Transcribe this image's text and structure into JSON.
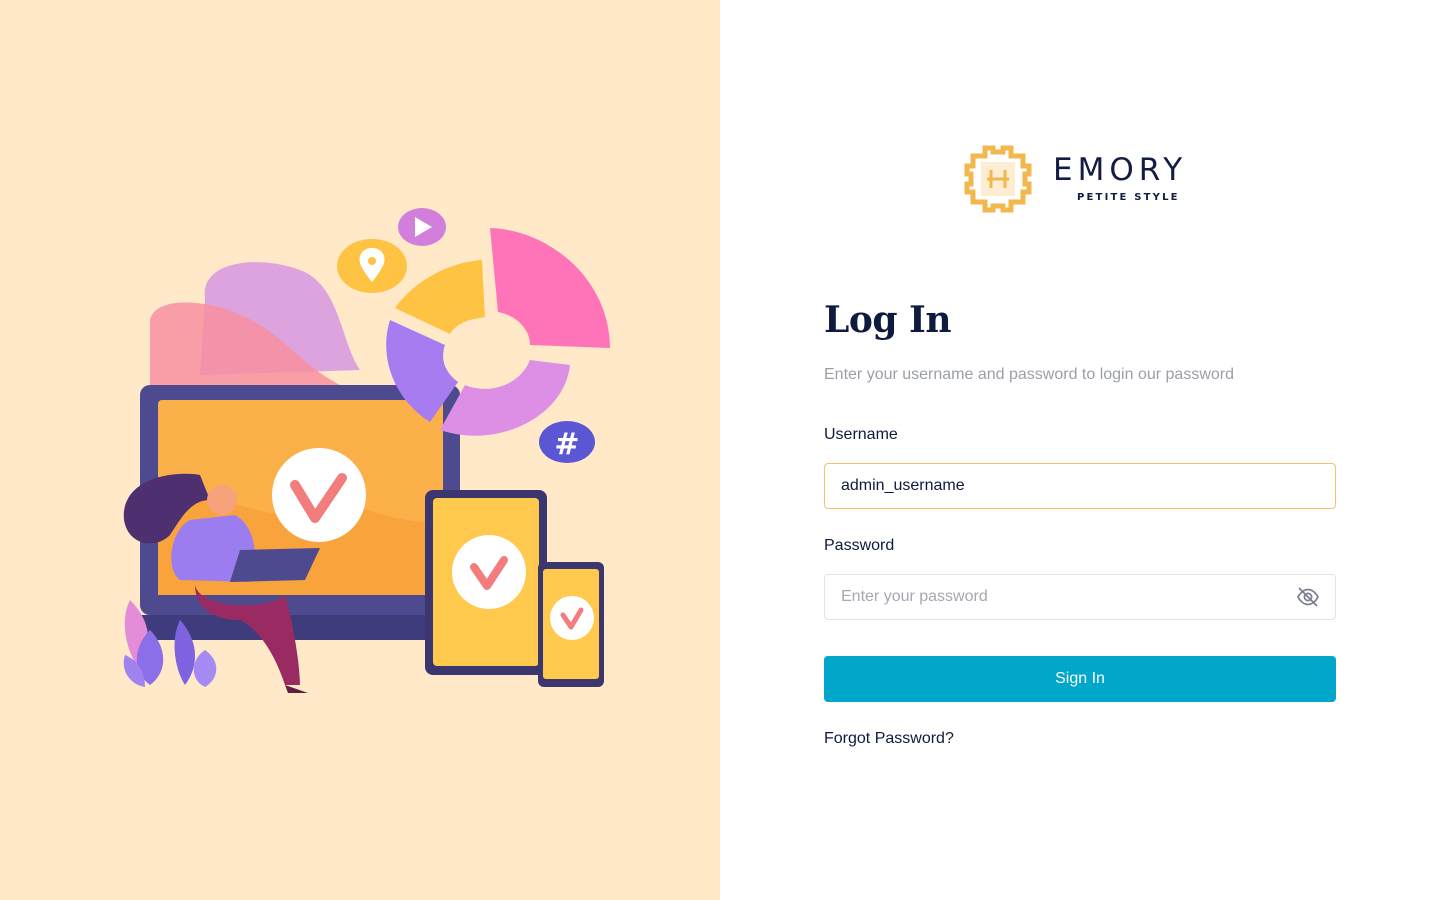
{
  "brand": {
    "name": "EMORY",
    "tagline": "PETITE STYLE",
    "accent_color": "#f2b84f"
  },
  "login": {
    "title": "Log In",
    "subtitle": "Enter your username and password to login our password",
    "username_label": "Username",
    "username_value": "admin_username",
    "password_label": "Password",
    "password_placeholder": "Enter your password",
    "password_toggle_icon": "eye-off-icon",
    "signin_label": "Sign In",
    "forgot_label": "Forgot Password?"
  },
  "colors": {
    "left_background": "#ffe9c9",
    "primary_button": "#00a7cb",
    "focus_border": "#f3c26a",
    "heading": "#0e1a3e",
    "muted_text": "#9a9fa8"
  },
  "illustration": {
    "icons": [
      "location-pin-icon",
      "play-icon",
      "hashtag-icon",
      "checkmark-icon"
    ]
  }
}
